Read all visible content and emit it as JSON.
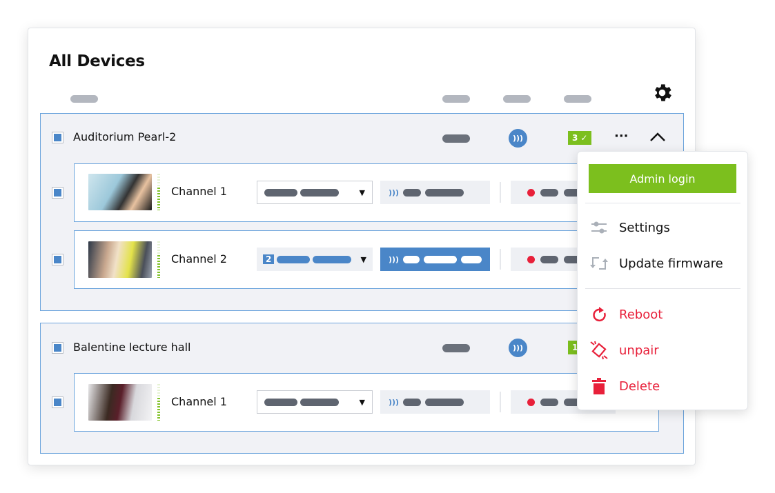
{
  "page": {
    "title": "All Devices"
  },
  "colors": {
    "accent": "#4a86c8",
    "success": "#7cbf1e",
    "danger": "#e8203a"
  },
  "devices": [
    {
      "name": "Auditorium Pearl-2",
      "badge_count": "3",
      "channels": [
        {
          "name": "Channel 1",
          "active": false
        },
        {
          "name": "Channel 2",
          "active": true,
          "selector_badge": "2"
        }
      ]
    },
    {
      "name": "Balentine lecture hall",
      "badge_count": "1",
      "channels": [
        {
          "name": "Channel 1",
          "active": false
        }
      ]
    }
  ],
  "menu": {
    "admin_login": "Admin login",
    "settings": "Settings",
    "update_firmware": "Update firmware",
    "reboot": "Reboot",
    "unpair": "unpair",
    "delete": "Delete"
  },
  "icons": {
    "gear": "gear-icon",
    "more": "more-icon",
    "collapse": "chevron-up-icon",
    "signal": "wireless-signal-icon",
    "check": "check-icon"
  }
}
